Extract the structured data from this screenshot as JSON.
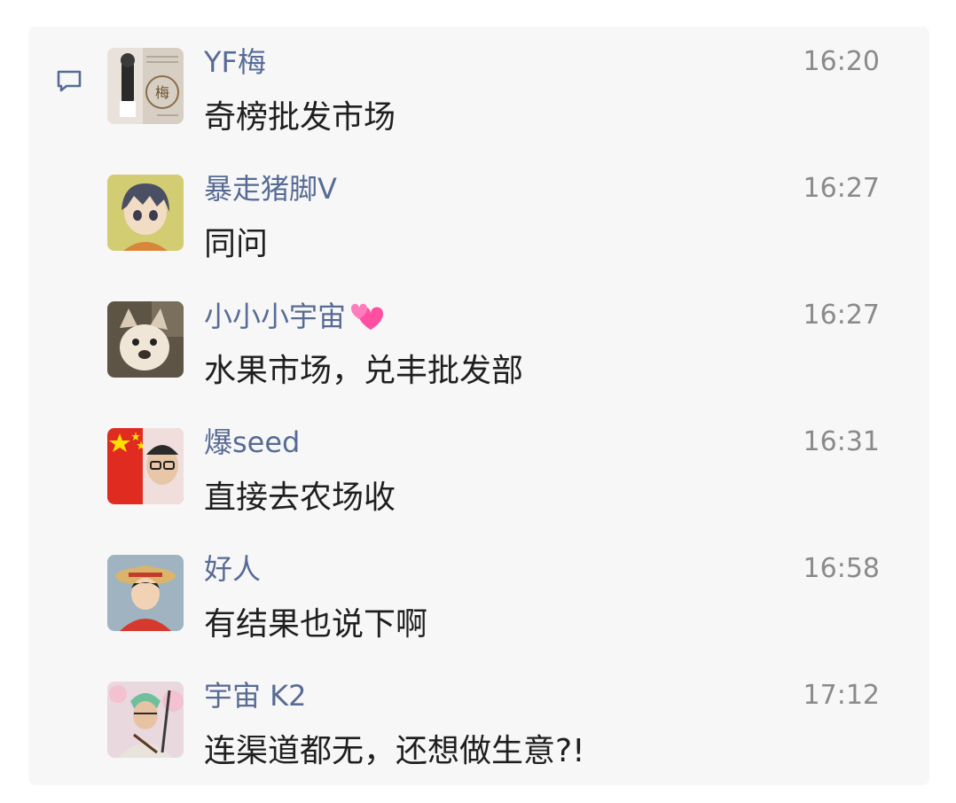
{
  "comments": [
    {
      "name": "YF梅",
      "time": "16:20",
      "text": "奇榜批发市场"
    },
    {
      "name": "暴走猪脚V",
      "time": "16:27",
      "text": "同问"
    },
    {
      "name": "小小小宇宙",
      "time": "16:27",
      "text": "水果市场，兑丰批发部"
    },
    {
      "name": "爆seed",
      "time": "16:31",
      "text": "直接去农场收"
    },
    {
      "name": "好人",
      "time": "16:58",
      "text": "有结果也说下啊"
    },
    {
      "name": "宇宙 K2",
      "time": "17:12",
      "text": "连渠道都无，还想做生意?!"
    }
  ],
  "icons": {
    "comment": "comment-bubble-icon",
    "name_emoji": "two-hearts-emoji"
  },
  "colors": {
    "name": "#576b95",
    "time": "#8a8a8a",
    "text": "#1f1f1f",
    "background": "#f7f7f7"
  }
}
